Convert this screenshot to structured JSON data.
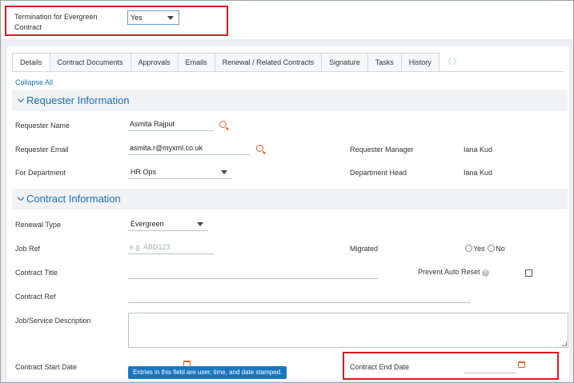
{
  "top": {
    "termination_label": "Termination for Evergreen Contract",
    "termination_value": "Yes"
  },
  "tabs": [
    "Details",
    "Contract Documents",
    "Approvals",
    "Emails",
    "Renewal / Related Contracts",
    "Signature",
    "Tasks",
    "History"
  ],
  "tab_scroll": "《 》",
  "collapse_all": "Collapse All",
  "requester_section": {
    "title": "Requester Information",
    "requester_name_label": "Requester Name",
    "requester_name_value": "Asmita Rajput",
    "requester_email_label": "Requester Email",
    "requester_email_value": "asmita.r@myxml.co.uk",
    "requester_manager_label": "Requester Manager",
    "requester_manager_value": "Iana Kud",
    "department_label": "For Department",
    "department_value": "HR Ops",
    "department_head_label": "Department Head",
    "department_head_value": "Iana Kud"
  },
  "contract_section": {
    "title": "Contract Information",
    "renewal_type_label": "Renewal Type",
    "renewal_type_value": "Evergreen",
    "job_ref_label": "Job Ref",
    "job_ref_placeholder": "e.g. ABD123",
    "migrated_label": "Migrated",
    "migrated_yes": "Yes",
    "migrated_no": "No",
    "contract_title_label": "Contract Title",
    "prevent_auto_reset_label": "Prevent Auto Reset",
    "help_glyph": "?",
    "contract_ref_label": "Contract Ref",
    "job_description_label": "Job/Service Description",
    "start_date_label": "Contract Start Date",
    "end_date_label": "Contract End Date",
    "tooltip": "Entries in this field are user, time, and date stamped."
  },
  "colors": {
    "accent": "#1a6fb3",
    "highlight_border": "#d71920",
    "icon": "#e2612a"
  }
}
